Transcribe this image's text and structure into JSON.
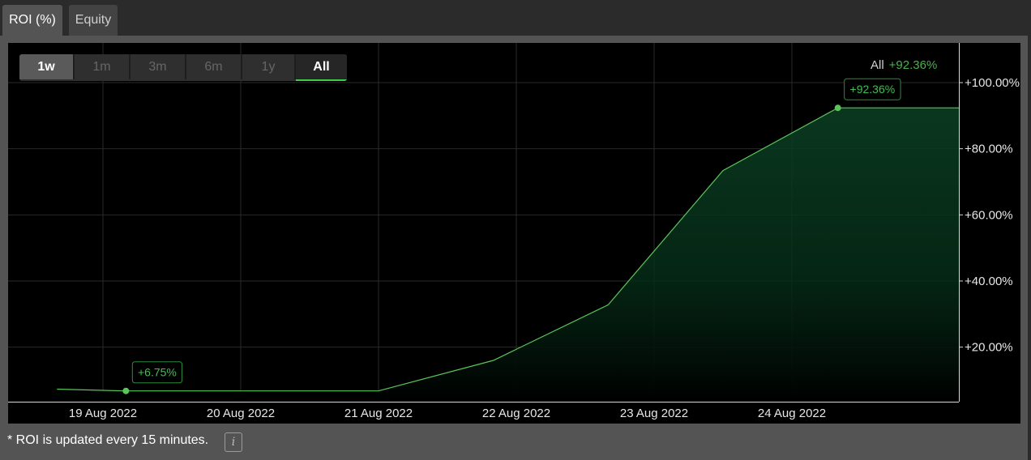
{
  "tabs": [
    {
      "label": "ROI (%)",
      "active": true
    },
    {
      "label": "Equity",
      "active": false
    }
  ],
  "range_buttons": [
    "1w",
    "1m",
    "3m",
    "6m",
    "1y",
    "All"
  ],
  "selected_range": "All",
  "legend": {
    "label": "All",
    "value": "+92.36%"
  },
  "footer": {
    "note": "* ROI is updated every 15 minutes.",
    "info_icon": "i"
  },
  "colors": {
    "line": "#5cc45c",
    "accent": "#4caf50",
    "background": "#000000"
  },
  "chart_data": {
    "type": "area",
    "x": [
      "18 Aug 2022 16:00",
      "19 Aug 2022 04:00",
      "21 Aug 2022 00:00",
      "21 Aug 2022 20:00",
      "22 Aug 2022 16:00",
      "23 Aug 2022 12:00",
      "24 Aug 2022 08:00",
      "25 Aug 2022 12:00"
    ],
    "series": [
      {
        "values": [
          7.3,
          6.75,
          6.75,
          16.0,
          32.8,
          73.4,
          92.36,
          92.36
        ]
      }
    ],
    "xticks": [
      "19 Aug 2022",
      "20 Aug 2022",
      "21 Aug 2022",
      "22 Aug 2022",
      "23 Aug 2022",
      "24 Aug 2022"
    ],
    "yticks": [
      "+20.00%",
      "+40.00%",
      "+60.00%",
      "+80.00%",
      "+100.00%"
    ],
    "ylim": [
      3.5,
      112
    ],
    "grid": true,
    "annotations": [
      {
        "x": "19 Aug 2022 04:00",
        "y": 6.75,
        "label": "+6.75%"
      },
      {
        "x": "24 Aug 2022 08:00",
        "y": 92.36,
        "label": "+92.36%"
      }
    ]
  }
}
